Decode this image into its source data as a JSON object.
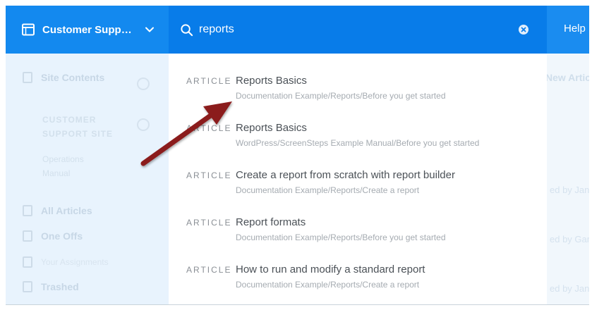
{
  "header": {
    "site_name": "Customer Support Site",
    "search_value": "reports",
    "help_label": "Help"
  },
  "sidebar": {
    "items": [
      {
        "label": "Site Contents"
      },
      {
        "label": "CUSTOMER"
      },
      {
        "label": "SUPPORT SITE"
      },
      {
        "label": "Operations"
      },
      {
        "label": "Manual"
      },
      {
        "label": "All Articles"
      },
      {
        "label": "One Offs"
      },
      {
        "label": "Your Assignments"
      },
      {
        "label": "Trashed"
      }
    ]
  },
  "background_right": {
    "title": "New Articles",
    "rows": [
      "ed by Jane D",
      "ed by Gary De",
      "ed by Jane W"
    ]
  },
  "results": [
    {
      "type": "ARTICLE",
      "title": "Reports Basics",
      "path": "Documentation Example/Reports/Before you get started"
    },
    {
      "type": "ARTICLE",
      "title": "Reports Basics",
      "path": "WordPress/ScreenSteps Example Manual/Before you get started"
    },
    {
      "type": "ARTICLE",
      "title": "Create a report from scratch with report builder",
      "path": "Documentation Example/Reports/Create a report"
    },
    {
      "type": "ARTICLE",
      "title": "Report formats",
      "path": "Documentation Example/Reports/Before you get started"
    },
    {
      "type": "ARTICLE",
      "title": "How to run and modify a standard report",
      "path": "Documentation Example/Reports/Create a report"
    }
  ],
  "colors": {
    "accent": "#1a8cf0",
    "search_bg": "#087ce9",
    "arrow": "#8b1a1a"
  },
  "icons": {
    "site": "browser-window-icon",
    "dropdown": "chevron-down-icon",
    "search": "search-icon",
    "clear": "close-circle-icon",
    "annotation": "annotation-arrow"
  }
}
